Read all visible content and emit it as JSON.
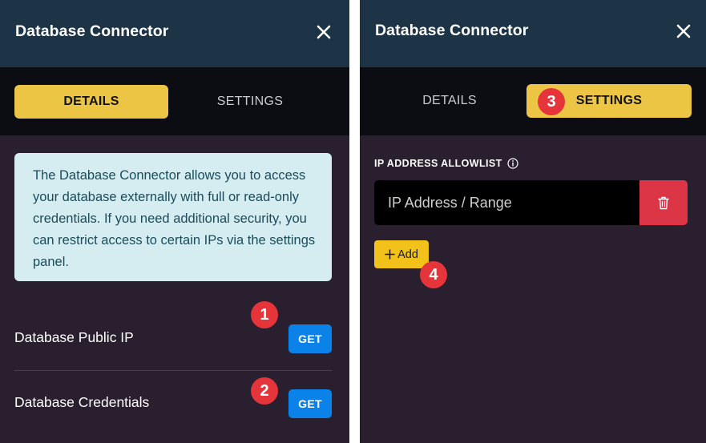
{
  "left_panel": {
    "title": "Database Connector",
    "tabs": {
      "details": "DETAILS",
      "settings": "SETTINGS"
    },
    "info_text": "The Database Connector allows you to access your database externally with full or read-only credentials. If you need additional security, you can restrict access to certain IPs via the settings panel.",
    "rows": [
      {
        "label": "Database Public IP",
        "button": "GET",
        "badge": "1"
      },
      {
        "label": "Database Credentials",
        "button": "GET",
        "badge": "2"
      }
    ]
  },
  "right_panel": {
    "title": "Database Connector",
    "tabs": {
      "details": "DETAILS",
      "settings": "SETTINGS"
    },
    "settings_badge": "3",
    "allowlist_label": "IP ADDRESS ALLOWLIST",
    "ip_placeholder": "IP Address / Range",
    "add_label": "Add",
    "add_badge": "4"
  },
  "icons": {
    "close": "close-icon",
    "info": "info-icon",
    "trash": "trash-icon",
    "plus": "plus-icon"
  },
  "colors": {
    "header_bg": "#1c3446",
    "tabbar_bg": "#0b0d12",
    "panel_bg": "#2a1f2f",
    "active_tab": "#edc544",
    "get_button": "#0a82e8",
    "delete_button": "#dc3545",
    "add_button": "#f2c21a",
    "badge": "#e5353a",
    "info_box_bg": "#d5ecf1"
  }
}
